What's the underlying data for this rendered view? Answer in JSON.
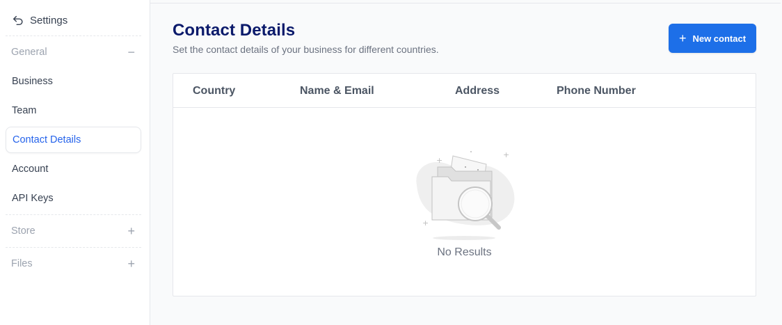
{
  "sidebar": {
    "back_label": "Settings",
    "sections": [
      {
        "label": "General",
        "toggle": "−",
        "expanded": true
      },
      {
        "label": "Store",
        "toggle": "+",
        "expanded": false
      },
      {
        "label": "Files",
        "toggle": "+",
        "expanded": false
      }
    ],
    "general_items": [
      "Business",
      "Team",
      "Contact Details",
      "Account",
      "API Keys"
    ],
    "active_item": "Contact Details"
  },
  "header": {
    "title": "Contact Details",
    "subtitle": "Set the contact details of your business for different countries.",
    "new_button_label": "New contact"
  },
  "table": {
    "columns": [
      "Country",
      "Name & Email",
      "Address",
      "Phone Number"
    ],
    "rows": [],
    "empty_text": "No Results"
  },
  "colors": {
    "accent": "#1d6fe8",
    "title": "#0b1a6b",
    "active_item": "#2563eb"
  },
  "icons": {
    "back": "undo-arrow-icon",
    "new": "plus-icon",
    "empty": "folder-magnifier-illustration"
  }
}
